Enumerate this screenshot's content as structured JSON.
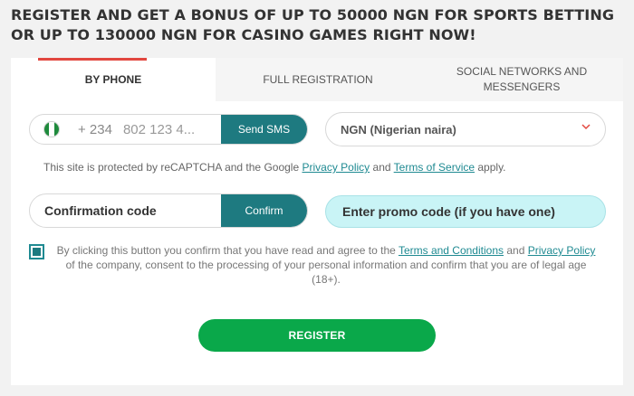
{
  "headline": "REGISTER AND GET A BONUS OF UP TO 50000 NGN FOR SPORTS BETTING OR UP TO 130000 NGN FOR CASINO GAMES RIGHT NOW!",
  "tabs": [
    {
      "label": "BY PHONE",
      "active": true
    },
    {
      "label": "FULL REGISTRATION",
      "active": false
    },
    {
      "label": "SOCIAL NETWORKS AND MESSENGERS",
      "active": false
    }
  ],
  "phone": {
    "country_flag": "nigeria-flag-icon",
    "code": "+ 234",
    "placeholder": "802 123 4...",
    "send_sms_label": "Send SMS"
  },
  "currency": {
    "selected": "NGN (Nigerian naira)",
    "icon": "chevron-down-icon"
  },
  "recaptcha": {
    "prefix": "This site is protected by reCAPTCHA and the Google",
    "privacy_link": "Privacy Policy",
    "and": "and",
    "terms_link": "Terms of Service",
    "suffix": "apply."
  },
  "confirmation": {
    "placeholder": "Confirmation code",
    "confirm_label": "Confirm"
  },
  "promo": {
    "placeholder": "Enter promo code (if you have one)"
  },
  "agreement": {
    "checked": true,
    "part1": "By clicking this button you confirm that you have read and agree to the",
    "terms_link": "Terms and Conditions",
    "and": "and",
    "privacy_link": "Privacy Policy",
    "part2": "of the company, consent to the processing of your personal information and confirm that you are of legal age (18+)."
  },
  "register_label": "REGISTER",
  "colors": {
    "accent_teal": "#1e7a80",
    "register_green": "#0aa84a",
    "active_tab_red": "#e2473f",
    "promo_bg": "#c9f4f6"
  }
}
